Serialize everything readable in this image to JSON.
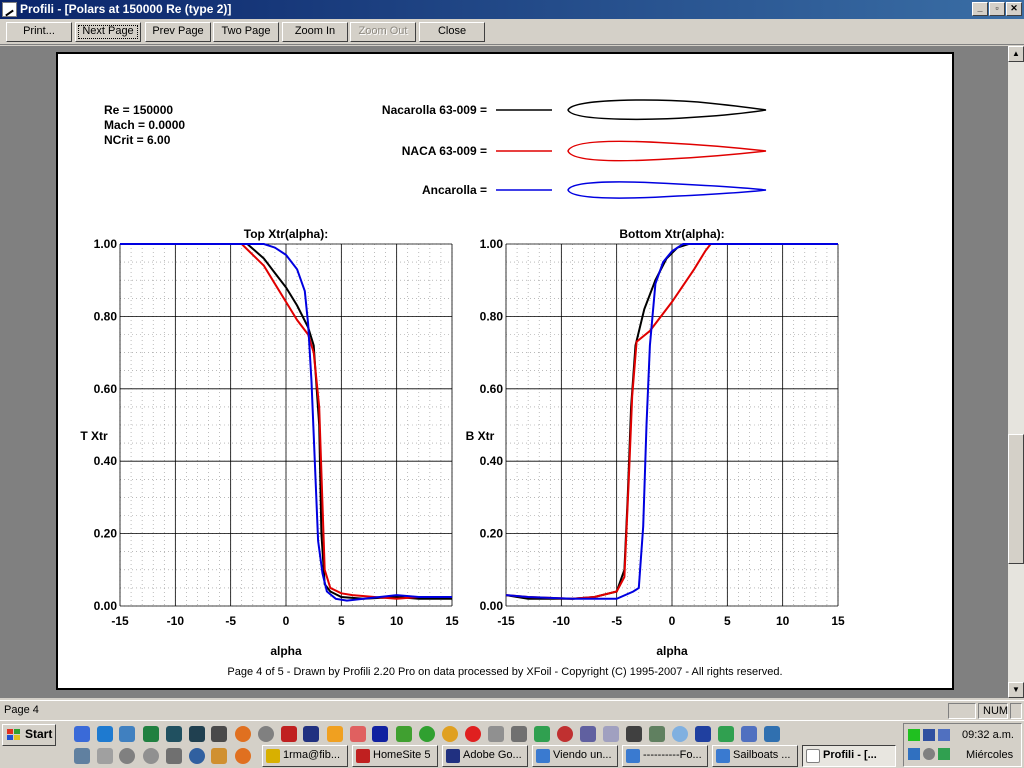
{
  "window": {
    "title": "Profili - [Polars at 150000 Re (type 2)]",
    "controls": {
      "minimize": "_",
      "restore": "▫",
      "close": "✕"
    }
  },
  "toolbar": {
    "buttons": [
      {
        "id": "print",
        "label": "Print...",
        "disabled": false
      },
      {
        "id": "next-page",
        "label": "Next Page",
        "disabled": false
      },
      {
        "id": "prev-page",
        "label": "Prev Page",
        "disabled": false
      },
      {
        "id": "two-page",
        "label": "Two Page",
        "disabled": false
      },
      {
        "id": "zoom-in",
        "label": "Zoom In",
        "disabled": false
      },
      {
        "id": "zoom-out",
        "label": "Zoom Out",
        "disabled": true
      },
      {
        "id": "close",
        "label": "Close",
        "disabled": false
      }
    ]
  },
  "document": {
    "conditions": [
      "Re = 150000",
      "Mach = 0.0000",
      "NCrit = 6.00"
    ],
    "legend": [
      {
        "label": "Nacarolla 63-009 =",
        "color": "#000000"
      },
      {
        "label": "NACA 63-009 =",
        "color": "#e00000"
      },
      {
        "label": "Ancarolla =",
        "color": "#0000e0"
      }
    ],
    "footer": "Page 4 of 5   -   Drawn by Profili 2.20 Pro on data processed by  XFoil - Copyright (C) 1995-2007 - All rights reserved."
  },
  "chart_data": [
    {
      "type": "line",
      "title": "Top Xtr(alpha):",
      "xlabel": "alpha",
      "ylabel": "T Xtr",
      "xlim": [
        -15,
        15
      ],
      "ylim": [
        0,
        1
      ],
      "x_ticks": [
        "-15",
        "-10",
        "-5",
        "0",
        "5",
        "10",
        "15"
      ],
      "y_ticks": [
        "0.00",
        "0.20",
        "0.40",
        "0.60",
        "0.80",
        "1.00"
      ],
      "grid": true,
      "series": [
        {
          "name": "Nacarolla 63-009",
          "color": "#000000",
          "points": [
            [
              -15,
              1.0
            ],
            [
              -3.5,
              1.0
            ],
            [
              -2,
              0.96
            ],
            [
              -1,
              0.92
            ],
            [
              0,
              0.88
            ],
            [
              1,
              0.83
            ],
            [
              2,
              0.77
            ],
            [
              2.5,
              0.72
            ],
            [
              3,
              0.5
            ],
            [
              3.2,
              0.2
            ],
            [
              3.5,
              0.06
            ],
            [
              4,
              0.04
            ],
            [
              5,
              0.025
            ],
            [
              7,
              0.02
            ],
            [
              10,
              0.025
            ],
            [
              12,
              0.02
            ],
            [
              15,
              0.02
            ]
          ]
        },
        {
          "name": "NACA 63-009",
          "color": "#e00000",
          "points": [
            [
              -15,
              1.0
            ],
            [
              -4,
              1.0
            ],
            [
              -2,
              0.94
            ],
            [
              -1,
              0.89
            ],
            [
              0,
              0.84
            ],
            [
              1,
              0.79
            ],
            [
              2,
              0.75
            ],
            [
              2.5,
              0.7
            ],
            [
              3,
              0.55
            ],
            [
              3.3,
              0.28
            ],
            [
              3.5,
              0.1
            ],
            [
              4,
              0.05
            ],
            [
              5,
              0.035
            ],
            [
              6,
              0.03
            ],
            [
              8,
              0.025
            ],
            [
              10,
              0.02
            ],
            [
              12,
              0.025
            ],
            [
              15,
              0.025
            ]
          ]
        },
        {
          "name": "Ancarolla",
          "color": "#0000e0",
          "points": [
            [
              -15,
              1.0
            ],
            [
              -2,
              1.0
            ],
            [
              -1,
              0.99
            ],
            [
              0,
              0.97
            ],
            [
              1,
              0.93
            ],
            [
              1.7,
              0.87
            ],
            [
              2,
              0.78
            ],
            [
              2.3,
              0.62
            ],
            [
              2.6,
              0.4
            ],
            [
              2.9,
              0.18
            ],
            [
              3.3,
              0.09
            ],
            [
              3.7,
              0.04
            ],
            [
              4.5,
              0.02
            ],
            [
              5.5,
              0.015
            ],
            [
              7,
              0.02
            ],
            [
              10,
              0.03
            ],
            [
              12,
              0.025
            ],
            [
              15,
              0.025
            ]
          ]
        }
      ]
    },
    {
      "type": "line",
      "title": "Bottom Xtr(alpha):",
      "xlabel": "alpha",
      "ylabel": "B Xtr",
      "xlim": [
        -15,
        15
      ],
      "ylim": [
        0,
        1
      ],
      "x_ticks": [
        "-15",
        "-10",
        "-5",
        "0",
        "5",
        "10",
        "15"
      ],
      "y_ticks": [
        "0.00",
        "0.20",
        "0.40",
        "0.60",
        "0.80",
        "1.00"
      ],
      "grid": true,
      "series": [
        {
          "name": "Nacarolla 63-009",
          "color": "#000000",
          "points": [
            [
              -15,
              0.03
            ],
            [
              -13,
              0.02
            ],
            [
              -9,
              0.02
            ],
            [
              -7,
              0.025
            ],
            [
              -5,
              0.04
            ],
            [
              -4.3,
              0.1
            ],
            [
              -4,
              0.3
            ],
            [
              -3.7,
              0.55
            ],
            [
              -3.3,
              0.72
            ],
            [
              -2.5,
              0.82
            ],
            [
              -1.5,
              0.9
            ],
            [
              -0.5,
              0.96
            ],
            [
              0.5,
              0.99
            ],
            [
              1.5,
              1.0
            ],
            [
              15,
              1.0
            ]
          ]
        },
        {
          "name": "NACA 63-009",
          "color": "#e00000",
          "points": [
            [
              -15,
              0.03
            ],
            [
              -13,
              0.025
            ],
            [
              -9,
              0.02
            ],
            [
              -7,
              0.025
            ],
            [
              -5,
              0.04
            ],
            [
              -4.3,
              0.08
            ],
            [
              -3.9,
              0.35
            ],
            [
              -3.6,
              0.58
            ],
            [
              -3.2,
              0.73
            ],
            [
              -2,
              0.76
            ],
            [
              0,
              0.84
            ],
            [
              2,
              0.93
            ],
            [
              3,
              0.98
            ],
            [
              3.5,
              1.0
            ],
            [
              15,
              1.0
            ]
          ]
        },
        {
          "name": "Ancarolla",
          "color": "#0000e0",
          "points": [
            [
              -15,
              0.03
            ],
            [
              -13,
              0.025
            ],
            [
              -9,
              0.02
            ],
            [
              -5,
              0.02
            ],
            [
              -3.5,
              0.04
            ],
            [
              -3,
              0.05
            ],
            [
              -2.6,
              0.22
            ],
            [
              -2.3,
              0.5
            ],
            [
              -2,
              0.72
            ],
            [
              -1.5,
              0.89
            ],
            [
              -0.8,
              0.95
            ],
            [
              0,
              0.98
            ],
            [
              1,
              1.0
            ],
            [
              15,
              1.0
            ]
          ]
        }
      ]
    }
  ],
  "statusbar": {
    "page": "Page 4",
    "num": "NUM"
  },
  "taskbar": {
    "start": "Start",
    "tasks": [
      {
        "label": "1rma@fib...",
        "color": "#d8b000",
        "active": false
      },
      {
        "label": "HomeSite 5",
        "color": "#c02020",
        "active": false
      },
      {
        "label": "Adobe Go...",
        "color": "#203080",
        "active": false
      },
      {
        "label": "Viendo un...",
        "color": "#3a7ad0",
        "active": false
      },
      {
        "label": "----------Fo...",
        "color": "#3a7ad0",
        "active": false
      },
      {
        "label": "Sailboats ...",
        "color": "#3a7ad0",
        "active": false
      },
      {
        "label": "Profili - [...",
        "color": "#ffffff",
        "active": true
      }
    ],
    "clock": "09:32 a.m.",
    "day": "Miércoles"
  }
}
